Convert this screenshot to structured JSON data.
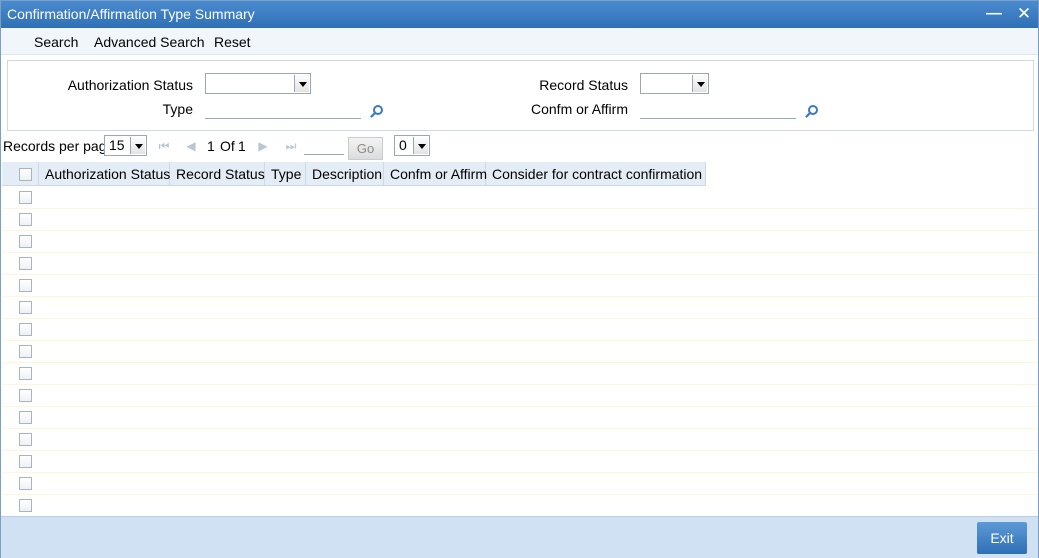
{
  "window": {
    "title": "Confirmation/Affirmation Type Summary",
    "minimize_icon": "minimize-icon",
    "close_icon": "close-icon"
  },
  "menu": {
    "search": "Search",
    "advanced_search": "Advanced Search",
    "reset": "Reset"
  },
  "criteria": {
    "authorization_status_label": "Authorization Status",
    "authorization_status_value": "",
    "record_status_label": "Record Status",
    "record_status_value": "",
    "type_label": "Type",
    "type_value": "",
    "confm_or_affirm_label": "Confm or Affirm",
    "confm_or_affirm_value": "",
    "lookup_icon": "search-icon"
  },
  "pager": {
    "records_per_page_label": "Records per page",
    "records_per_page_value": "15",
    "current_page": "1",
    "of_label": "Of",
    "total_pages": "1",
    "go_label": "Go",
    "goto_value": "",
    "selected_count": "0"
  },
  "grid": {
    "columns": [
      "Authorization Status",
      "Record Status",
      "Type",
      "Description",
      "Confm or Affirm",
      "Consider for contract confirmation"
    ],
    "row_count": 15,
    "rows": []
  },
  "footer": {
    "exit_label": "Exit"
  },
  "colors": {
    "titlebar": "#2f6fb5",
    "header_bg": "#e4edf6",
    "footer_bg": "#cfe1f2",
    "exit_button": "#2f6fb5"
  }
}
